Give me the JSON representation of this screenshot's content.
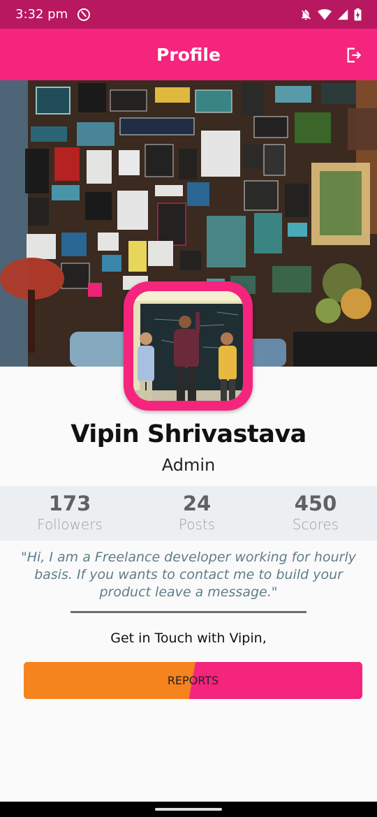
{
  "status_bar": {
    "time": "3:32 pm"
  },
  "app_bar": {
    "title": "Profile"
  },
  "profile": {
    "name": "Vipin Shrivastava",
    "role": "Admin",
    "stats": [
      {
        "value": "173",
        "label": "Followers"
      },
      {
        "value": "24",
        "label": "Posts"
      },
      {
        "value": "450",
        "label": "Scores"
      }
    ],
    "quote": "\"Hi, I am a Freelance developer working for hourly basis. If you wants to contact me to build your product leave a message.\"",
    "contact_text": "Get in Touch with Vipin,",
    "button_label": "REPORTS"
  },
  "colors": {
    "status_bar": "#b8185f",
    "app_bar": "#f5247d",
    "button_left": "#f5841f",
    "button_right": "#f5247d",
    "stats_bg": "#eceff1",
    "quote_text": "#607d8b"
  }
}
